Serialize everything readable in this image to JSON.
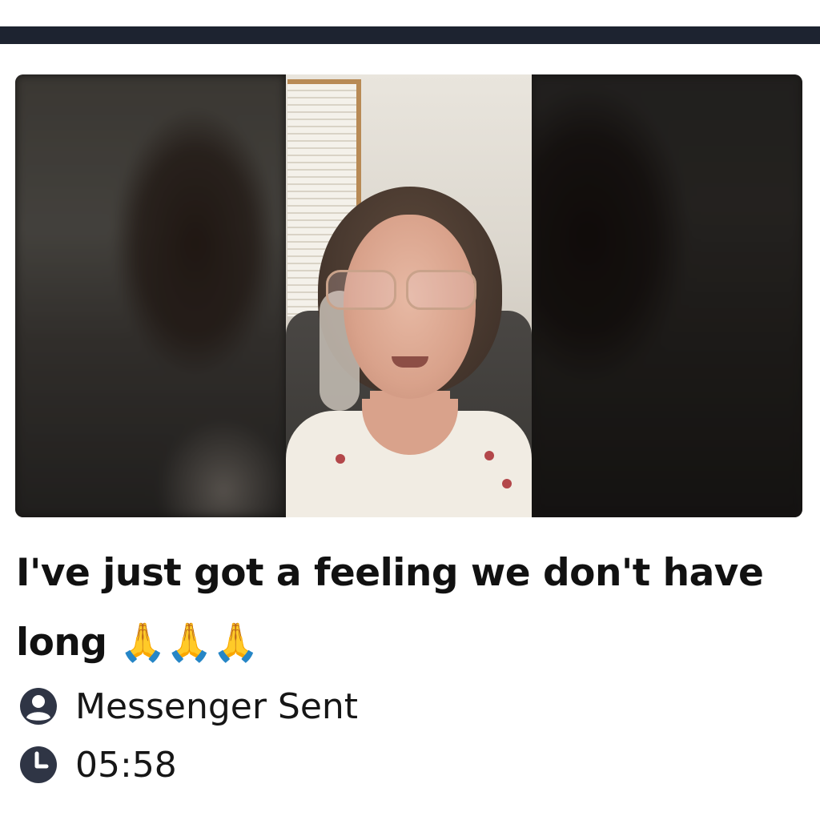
{
  "post": {
    "title": "I've just got a feeling we don't have long 🙏🙏🙏"
  },
  "meta": {
    "sender": {
      "icon": "user-circle-icon",
      "text": "Messenger Sent"
    },
    "time": {
      "icon": "clock-icon",
      "text": "05:58"
    }
  },
  "colors": {
    "top_bar": "#1d2330",
    "text": "#111111",
    "icon": "#2f3545"
  }
}
